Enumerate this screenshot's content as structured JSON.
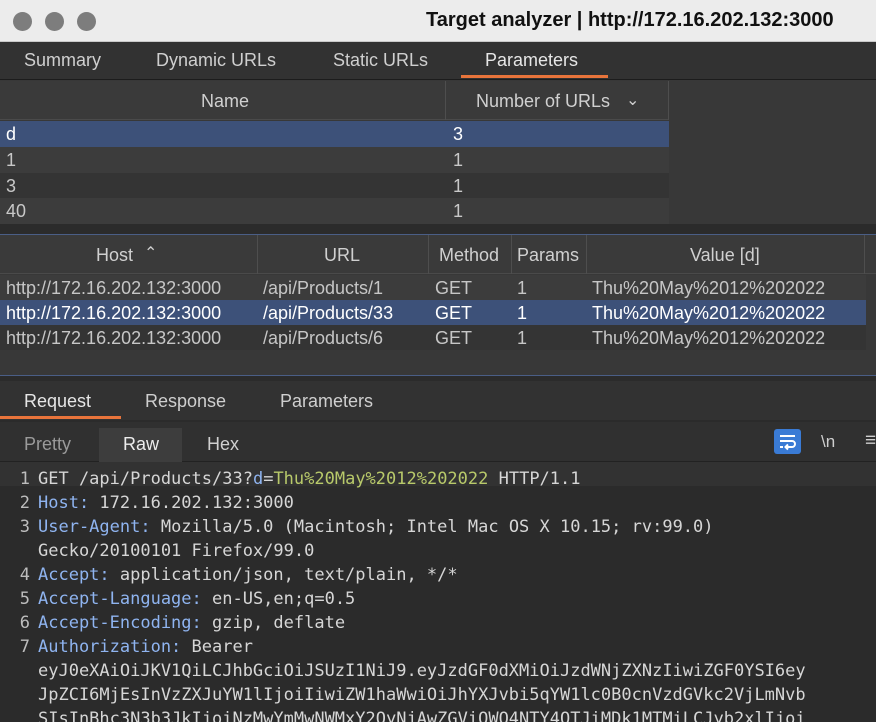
{
  "window": {
    "title": "Target analyzer | http://172.16.202.132:3000"
  },
  "top_tabs": [
    "Summary",
    "Dynamic URLs",
    "Static URLs",
    "Parameters"
  ],
  "params_table": {
    "headers": [
      "Name",
      "Number of URLs"
    ],
    "rows": [
      {
        "name": "d",
        "count": "3"
      },
      {
        "name": "1",
        "count": "1"
      },
      {
        "name": "3",
        "count": "1"
      },
      {
        "name": "40",
        "count": "1"
      }
    ]
  },
  "urls_table": {
    "headers": [
      "Host",
      "URL",
      "Method",
      "Params",
      "Value [d]"
    ],
    "rows": [
      {
        "host": "http://172.16.202.132:3000",
        "url": "/api/Products/1",
        "method": "GET",
        "params": "1",
        "value": "Thu%20May%2012%202022"
      },
      {
        "host": "http://172.16.202.132:3000",
        "url": "/api/Products/33",
        "method": "GET",
        "params": "1",
        "value": "Thu%20May%2012%202022"
      },
      {
        "host": "http://172.16.202.132:3000",
        "url": "/api/Products/6",
        "method": "GET",
        "params": "1",
        "value": "Thu%20May%2012%202022"
      }
    ]
  },
  "detail_tabs": [
    "Request",
    "Response",
    "Parameters"
  ],
  "view_tabs": [
    "Pretty",
    "Raw",
    "Hex"
  ],
  "editor_options": {
    "newline_label": "\\n"
  },
  "request": {
    "l1_prefix": "GET /api/Products/33?",
    "l1_param": "d",
    "l1_eq": "=",
    "l1_value": "Thu%20May%2012%202022",
    "l1_suffix": " HTTP/1.1",
    "host_key": "Host:",
    "host_val": " 172.16.202.132:3000",
    "ua_key": "User-Agent:",
    "ua_val": " Mozilla/5.0 (Macintosh; Intel Mac OS X 10.15; rv:99.0)",
    "ua_val2": "Gecko/20100101 Firefox/99.0",
    "accept_key": "Accept:",
    "accept_val": " application/json, text/plain, */*",
    "lang_key": "Accept-Language:",
    "lang_val": " en-US,en;q=0.5",
    "enc_key": "Accept-Encoding:",
    "enc_val": " gzip, deflate",
    "auth_key": "Authorization:",
    "auth_val": " Bearer",
    "auth_l2": "eyJ0eXAiOiJKV1QiLCJhbGciOiJSUzI1NiJ9.eyJzdGF0dXMiOiJzdWNjZXNzIiwiZGF0YSI6ey",
    "auth_l3": "JpZCI6MjEsInVzZXJuYW1lIjoiIiwiZW1haWwiOiJhYXJvbi5qYW1lc0B0cnVzdGVkc2VjLmNvb",
    "auth_l4": "SIsInBhc3N3b3JkIjoiNzMwYmMwNWMxY2QyNjAwZGViOWQ4NTY4OTJiMDk1MTMiLCJyb2xlIjoi"
  },
  "colors": {
    "accent": "#e8743b",
    "selection": "#3d5179",
    "key": "#8fb4f0",
    "param_value": "#b8c96a",
    "toggle": "#3a7bd5"
  }
}
